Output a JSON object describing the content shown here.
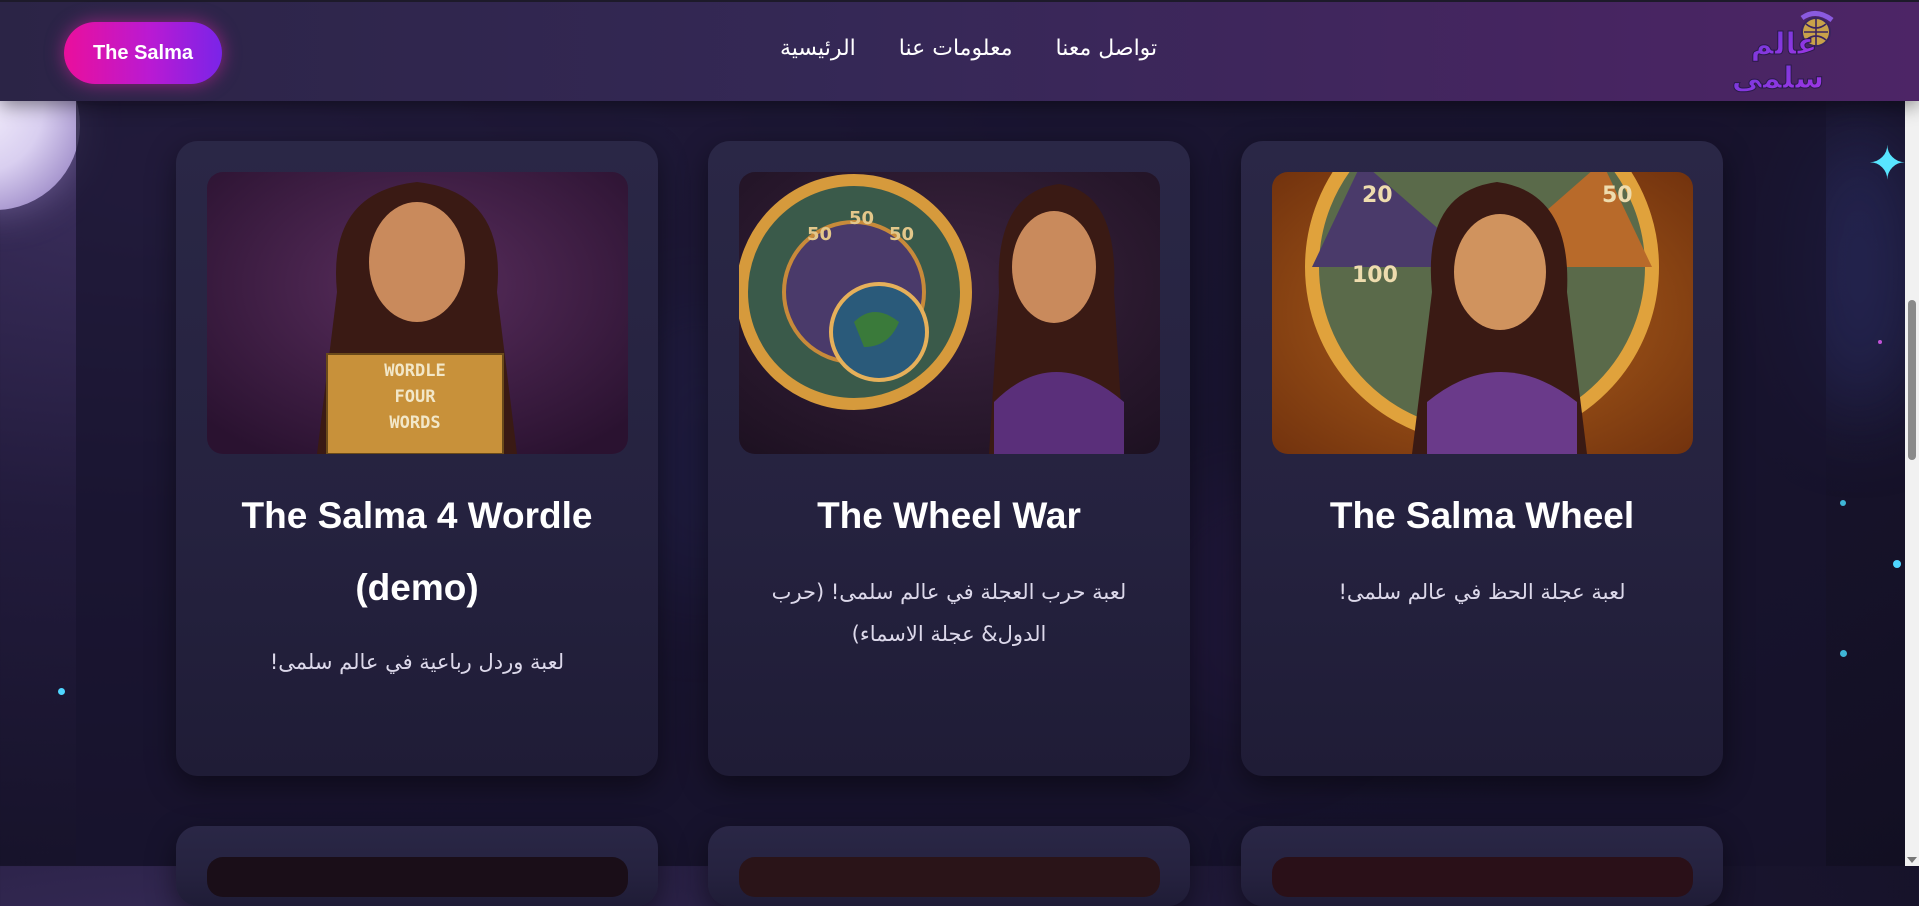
{
  "navbar": {
    "brand_button": "The Salma",
    "links": [
      "الرئيسية",
      "معلومات عنا",
      "تواصل معنا"
    ],
    "logo_text_line1": "عالم",
    "logo_text_line2": "سلمى"
  },
  "cards": [
    {
      "title": "The Salma Wheel",
      "description": "لعبة عجلة الحظ في عالم سلمى!",
      "image_icon": "girl-with-fortune-wheel-image"
    },
    {
      "title": "The Wheel War",
      "description": "لعبة حرب العجلة في عالم سلمى! (حرب الدول& عجلة الاسماء)",
      "image_icon": "girl-with-globe-wheel-image"
    },
    {
      "title": "The Salma 4 Wordle (demo)",
      "description": "لعبة وردل رباعية في عالم سلمى!",
      "image_icon": "girl-with-wordle-board-image",
      "board_words": [
        "WORDLE",
        "FOUR",
        "WORDS"
      ]
    }
  ],
  "colors": {
    "brand_gradient_start": "#ea0f9c",
    "brand_gradient_end": "#7a24e8",
    "card_bg": "#2a2746",
    "nav_bg": "#352856"
  }
}
